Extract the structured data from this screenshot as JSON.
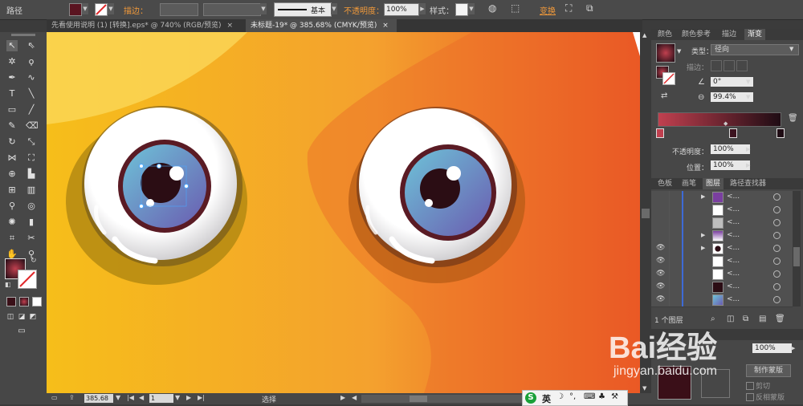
{
  "control_bar": {
    "object_label": "路径",
    "stroke_label": "描边：",
    "stroke_style": "基本",
    "opacity_label": "不透明度：",
    "opacity_value": "100%",
    "style_label": "样式：",
    "transform_label": "变换"
  },
  "tabs": [
    {
      "label": "先看使用说明 (1) [转换].eps* @ 740% (RGB/预览)"
    },
    {
      "label": "未标题-19* @ 385.68% (CMYK/预览)"
    }
  ],
  "gradient_panel": {
    "tabs": [
      "颜色",
      "颜色参考",
      "描边",
      "渐变"
    ],
    "type_label": "类型：",
    "type_value": "径向",
    "stroke_label": "描边：",
    "angle_value": "0°",
    "aspect_value": "99.4%",
    "opacity_label": "不透明度：",
    "opacity_value": "100%",
    "location_label": "位置：",
    "location_value": "100%",
    "start_color": "#c0404f",
    "end_color": "#1f0c14"
  },
  "layers_panel": {
    "tabs": [
      "色板",
      "画笔",
      "图层",
      "路径查找器"
    ],
    "rows": [
      {
        "name": "<...",
        "expand": true,
        "thumb": "purple",
        "eye": false
      },
      {
        "name": "<...",
        "expand": false,
        "thumb": "white",
        "eye": false
      },
      {
        "name": "<...",
        "expand": false,
        "thumb": "gray",
        "eye": false
      },
      {
        "name": "<...",
        "expand": true,
        "thumb": "mixed",
        "eye": false
      },
      {
        "name": "<...",
        "expand": true,
        "thumb": "eye",
        "eye": true
      },
      {
        "name": "<...",
        "expand": false,
        "thumb": "white",
        "eye": true
      },
      {
        "name": "<...",
        "expand": false,
        "thumb": "white",
        "eye": true
      },
      {
        "name": "<...",
        "expand": false,
        "thumb": "dark",
        "eye": true
      },
      {
        "name": "<...",
        "expand": false,
        "thumb": "blue",
        "eye": true
      }
    ],
    "layer_count": "1 个图层"
  },
  "transparency_panel": {
    "opacity_value": "100%",
    "make_mask_label": "制作蒙版",
    "clip_label": "剪切",
    "invert_label": "反相蒙版"
  },
  "status_bar": {
    "zoom_value": "385.68",
    "page_value": "1",
    "tool_label": "选择"
  },
  "watermark": {
    "logo_text": "Bai经验",
    "url": "jingyan.baidu.com"
  },
  "ime_bar": {
    "lang": "英"
  },
  "colors": {
    "bg_left": "#f6be1a",
    "bg_right": "#e94b24",
    "iris_light": "#6ec3d8",
    "iris_dark": "#6a5bb0",
    "pupil": "#2b0d14",
    "rim": "#5a1b24"
  }
}
